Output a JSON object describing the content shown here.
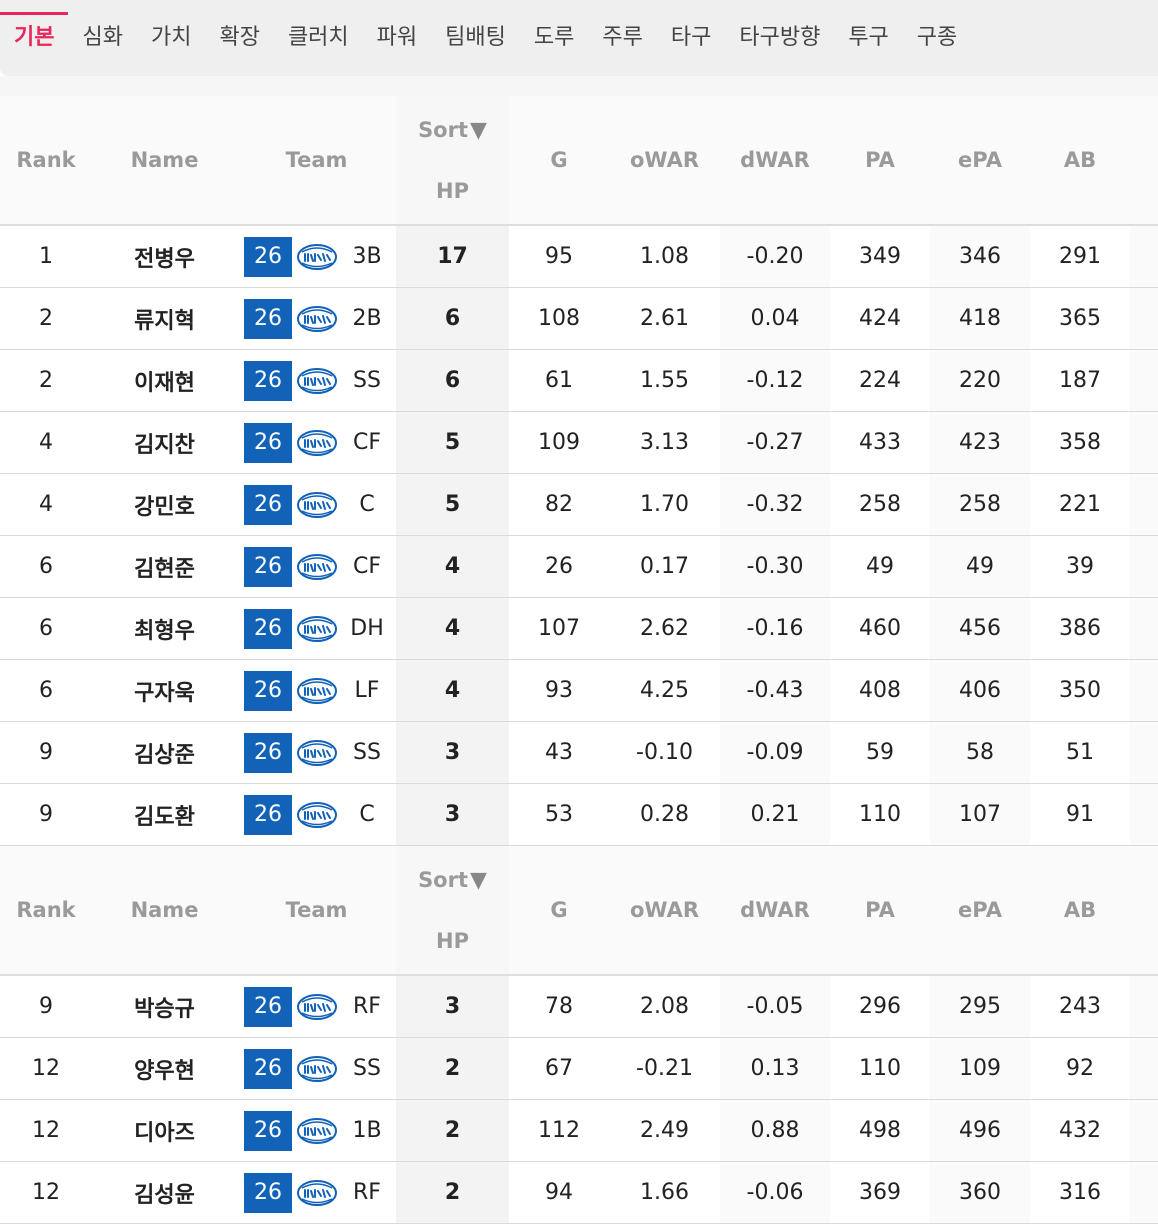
{
  "tabs": [
    "기본",
    "심화",
    "가치",
    "확장",
    "클러치",
    "파워",
    "팀배팅",
    "도루",
    "주루",
    "타구",
    "타구방향",
    "투구",
    "구종"
  ],
  "active_tab": 0,
  "header": {
    "rank": "Rank",
    "name": "Name",
    "team": "Team",
    "sort": "Sort",
    "sort_arrow": "▼",
    "hp": "HP",
    "g": "G",
    "owar": "oWAR",
    "dwar": "dWAR",
    "pa": "PA",
    "epa": "ePA",
    "ab": "AB"
  },
  "team_logo_icon": "lions-logo-icon",
  "rows_group1": [
    {
      "rank": "1",
      "name": "전병우",
      "year": "26",
      "pos": "3B",
      "hp": "17",
      "g": "95",
      "owar": "1.08",
      "dwar": "-0.20",
      "pa": "349",
      "epa": "346",
      "ab": "291"
    },
    {
      "rank": "2",
      "name": "류지혁",
      "year": "26",
      "pos": "2B",
      "hp": "6",
      "g": "108",
      "owar": "2.61",
      "dwar": "0.04",
      "pa": "424",
      "epa": "418",
      "ab": "365"
    },
    {
      "rank": "2",
      "name": "이재현",
      "year": "26",
      "pos": "SS",
      "hp": "6",
      "g": "61",
      "owar": "1.55",
      "dwar": "-0.12",
      "pa": "224",
      "epa": "220",
      "ab": "187"
    },
    {
      "rank": "4",
      "name": "김지찬",
      "year": "26",
      "pos": "CF",
      "hp": "5",
      "g": "109",
      "owar": "3.13",
      "dwar": "-0.27",
      "pa": "433",
      "epa": "423",
      "ab": "358"
    },
    {
      "rank": "4",
      "name": "강민호",
      "year": "26",
      "pos": "C",
      "hp": "5",
      "g": "82",
      "owar": "1.70",
      "dwar": "-0.32",
      "pa": "258",
      "epa": "258",
      "ab": "221"
    },
    {
      "rank": "6",
      "name": "김현준",
      "year": "26",
      "pos": "CF",
      "hp": "4",
      "g": "26",
      "owar": "0.17",
      "dwar": "-0.30",
      "pa": "49",
      "epa": "49",
      "ab": "39"
    },
    {
      "rank": "6",
      "name": "최형우",
      "year": "26",
      "pos": "DH",
      "hp": "4",
      "g": "107",
      "owar": "2.62",
      "dwar": "-0.16",
      "pa": "460",
      "epa": "456",
      "ab": "386"
    },
    {
      "rank": "6",
      "name": "구자욱",
      "year": "26",
      "pos": "LF",
      "hp": "4",
      "g": "93",
      "owar": "4.25",
      "dwar": "-0.43",
      "pa": "408",
      "epa": "406",
      "ab": "350"
    },
    {
      "rank": "9",
      "name": "김상준",
      "year": "26",
      "pos": "SS",
      "hp": "3",
      "g": "43",
      "owar": "-0.10",
      "dwar": "-0.09",
      "pa": "59",
      "epa": "58",
      "ab": "51"
    },
    {
      "rank": "9",
      "name": "김도환",
      "year": "26",
      "pos": "C",
      "hp": "3",
      "g": "53",
      "owar": "0.28",
      "dwar": "0.21",
      "pa": "110",
      "epa": "107",
      "ab": "91"
    }
  ],
  "rows_group2": [
    {
      "rank": "9",
      "name": "박승규",
      "year": "26",
      "pos": "RF",
      "hp": "3",
      "g": "78",
      "owar": "2.08",
      "dwar": "-0.05",
      "pa": "296",
      "epa": "295",
      "ab": "243"
    },
    {
      "rank": "12",
      "name": "양우현",
      "year": "26",
      "pos": "SS",
      "hp": "2",
      "g": "67",
      "owar": "-0.21",
      "dwar": "0.13",
      "pa": "110",
      "epa": "109",
      "ab": "92"
    },
    {
      "rank": "12",
      "name": "디아즈",
      "year": "26",
      "pos": "1B",
      "hp": "2",
      "g": "112",
      "owar": "2.49",
      "dwar": "0.88",
      "pa": "498",
      "epa": "496",
      "ab": "432"
    },
    {
      "rank": "12",
      "name": "김성윤",
      "year": "26",
      "pos": "RF",
      "hp": "2",
      "g": "94",
      "owar": "1.66",
      "dwar": "-0.06",
      "pa": "369",
      "epa": "360",
      "ab": "316"
    }
  ],
  "colors": {
    "accent": "#e8275c",
    "badge": "#1262b8",
    "header_text": "#9a9a9a"
  }
}
